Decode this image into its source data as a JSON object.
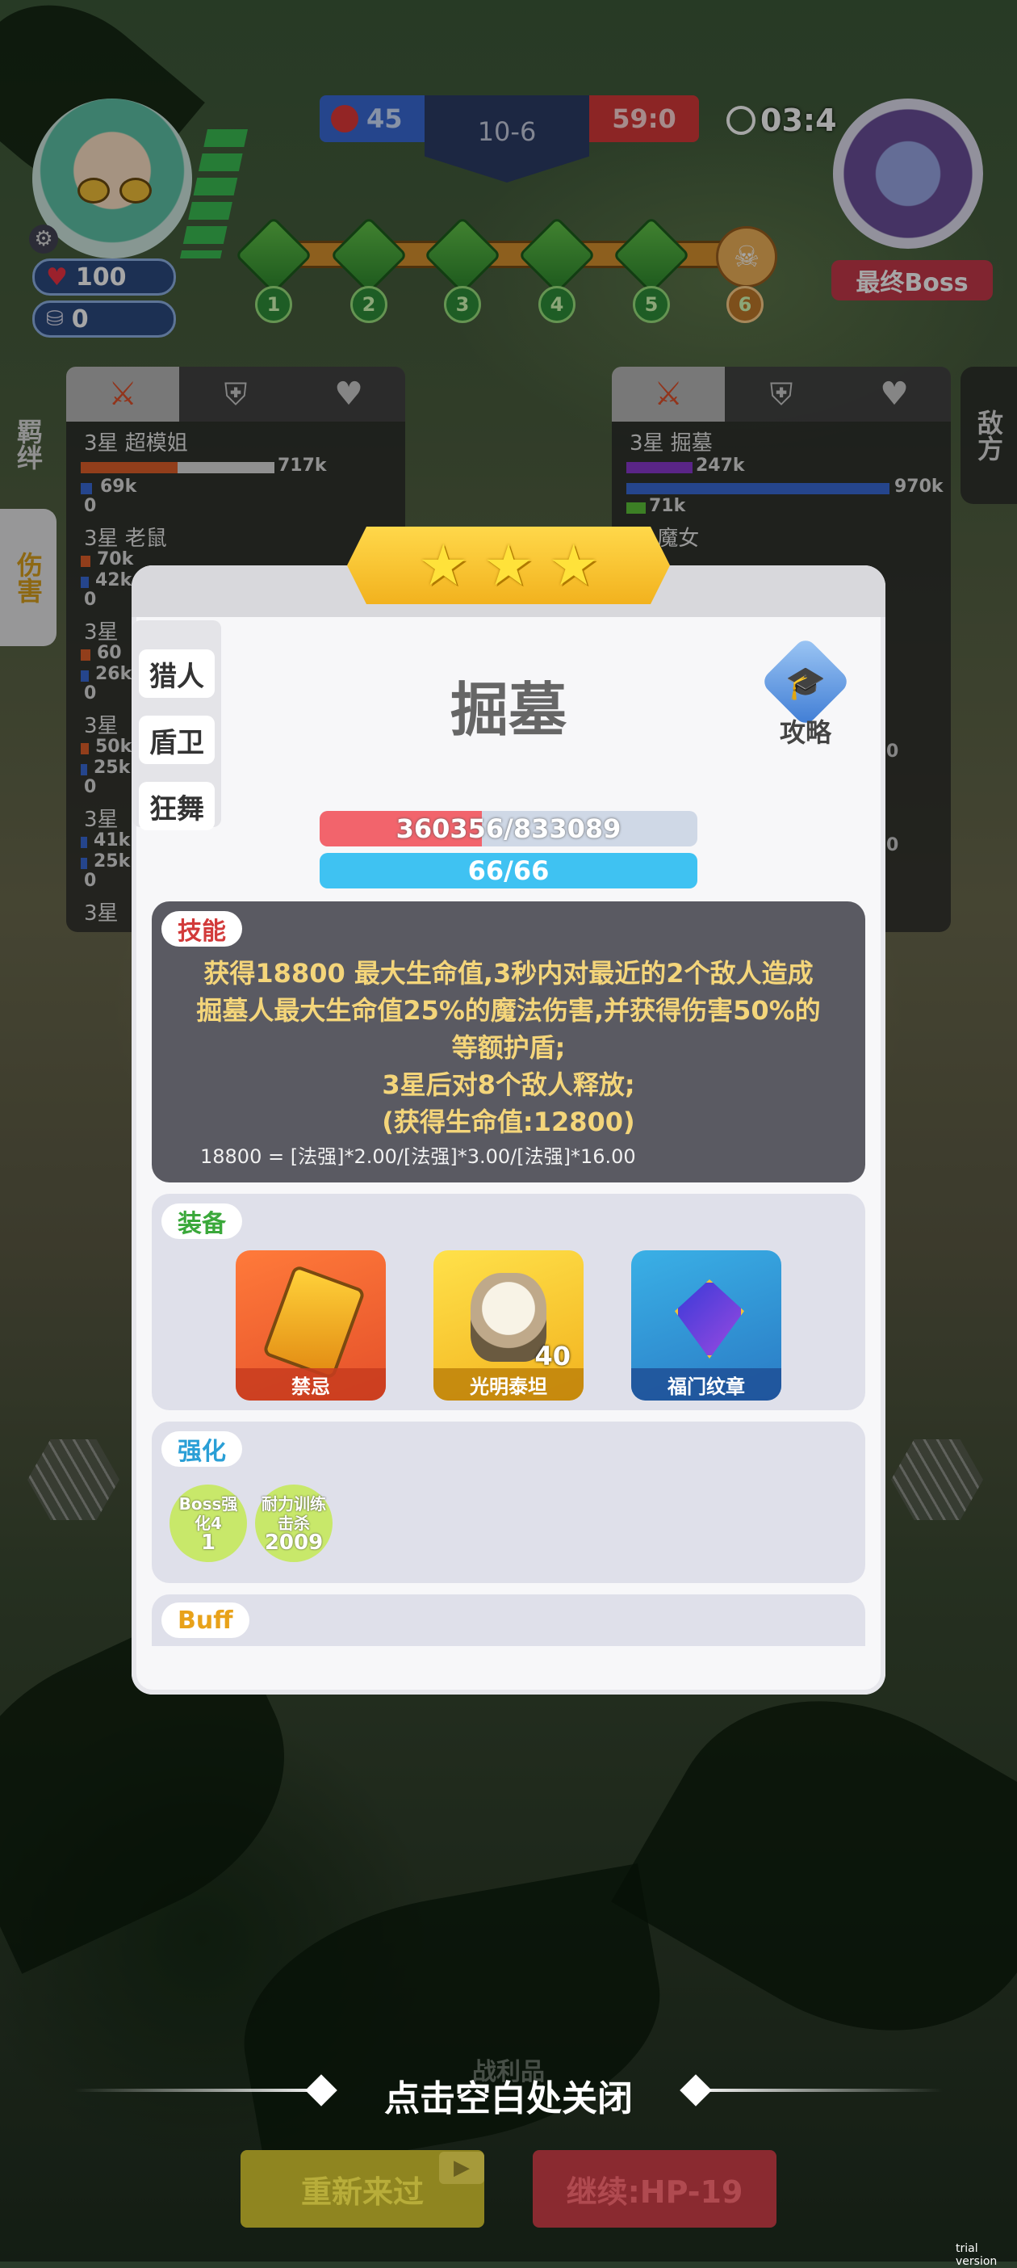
{
  "hud": {
    "player_hp": "100",
    "player_coins": "0",
    "kills_left": "45",
    "stage": "10-6",
    "score": "59:0",
    "timer": "03:4",
    "boss_label": "最终Boss",
    "waves": [
      "1",
      "2",
      "3",
      "4",
      "5",
      "6"
    ]
  },
  "sidebar": {
    "left_tabs": [
      "羁绊",
      "伤害"
    ],
    "right_tab": "敌方"
  },
  "left_panel": {
    "rows": [
      {
        "name": "3星 超模姐",
        "value1": "717k",
        "value2": "69k",
        "value3": "0"
      },
      {
        "name": "3星 老鼠",
        "value1": "70k",
        "value2": "42k",
        "value3": "0"
      },
      {
        "name": "3星",
        "value1": "60",
        "value2": "26k",
        "value3": "0"
      },
      {
        "name": "3星",
        "value1": "50k",
        "value2": "25k",
        "value3": "0"
      },
      {
        "name": "3星",
        "value1": "41k",
        "value2": "25k",
        "value3": "0"
      },
      {
        "name": "3星",
        "value1": "",
        "value2": "",
        "value3": ""
      }
    ]
  },
  "right_panel": {
    "rows": [
      {
        "name": "3星 掘墓",
        "value1": "247k",
        "value2": "970k",
        "value3": "71k"
      },
      {
        "name": "星 魔女",
        "value1": "",
        "value2": "",
        "value3": ""
      }
    ],
    "peek_values": [
      "0",
      "0"
    ]
  },
  "unit": {
    "stars": 3,
    "name": "掘墓",
    "traits": [
      "猎人",
      "盾卫",
      "狂舞"
    ],
    "guide_label": "攻略",
    "hp_text": "360356/833089",
    "hp_fraction": 0.43,
    "mana_text": "66/66",
    "mana_fraction": 1.0
  },
  "skill": {
    "tag": "技能",
    "lines": [
      "获得18800 最大生命值,3秒内对最近的2个敌人造成",
      "掘墓人最大生命值25%的魔法伤害,并获得伤害50%的",
      "等额护盾;",
      "3星后对8个敌人释放;",
      "(获得生命值:12800)"
    ],
    "formula": "18800 = [法强]*2.00/[法强]*3.00/[法强]*16.00"
  },
  "equipment": {
    "tag": "装备",
    "items": [
      {
        "label": "禁忌",
        "badge": ""
      },
      {
        "label": "光明泰坦",
        "badge": "40"
      },
      {
        "label": "福门纹章",
        "badge": ""
      }
    ]
  },
  "enhance": {
    "tag": "强化",
    "items": [
      {
        "line1": "Boss强",
        "line2": "化4",
        "count": "1"
      },
      {
        "line1": "耐力训练",
        "line2": "击杀",
        "count": "2009"
      }
    ]
  },
  "buff": {
    "tag": "Buff"
  },
  "footer": {
    "loot_label": "战利品",
    "close_hint": "点击空白处关闭",
    "retry_label": "重新来过",
    "continue_label": "继续:HP-19",
    "watermark": "trial version"
  }
}
